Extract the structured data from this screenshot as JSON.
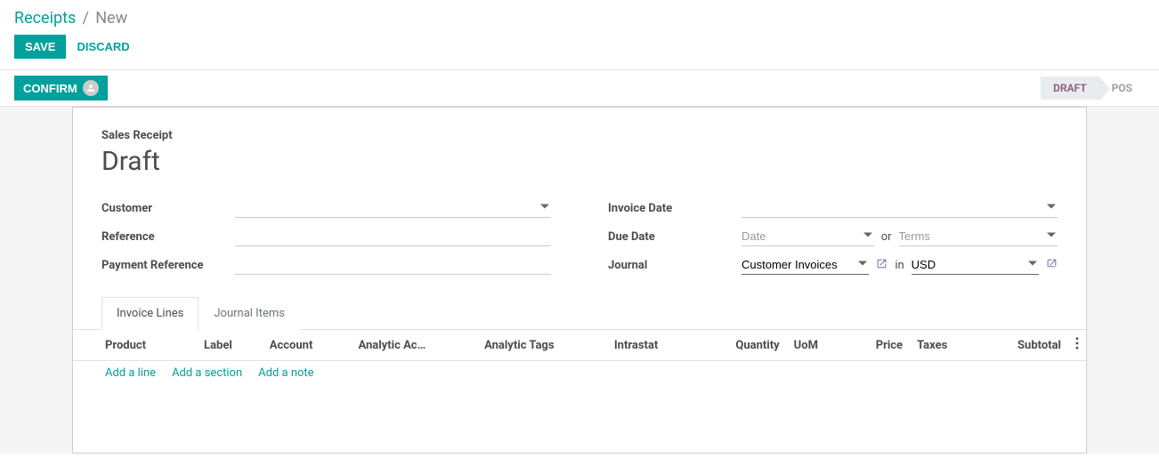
{
  "breadcrumb": {
    "root": "Receipts",
    "sep": "/",
    "current": "New"
  },
  "actions": {
    "save": "Save",
    "discard": "Discard"
  },
  "status": {
    "confirm": "Confirm",
    "draft": "Draft",
    "posted": "Pos"
  },
  "sheet": {
    "title_label": "Sales Receipt",
    "title": "Draft",
    "left_fields": {
      "customer_label": "Customer",
      "reference_label": "Reference",
      "payment_ref_label": "Payment Reference"
    },
    "right_fields": {
      "invoice_date_label": "Invoice Date",
      "due_date_label": "Due Date",
      "due_date_placeholder": "Date",
      "due_date_or": "or",
      "terms_placeholder": "Terms",
      "journal_label": "Journal",
      "journal_value": "Customer Invoices",
      "journal_in": "in",
      "currency_value": "USD"
    }
  },
  "tabs": {
    "invoice_lines": "Invoice Lines",
    "journal_items": "Journal Items"
  },
  "table": {
    "headers": {
      "product": "Product",
      "label": "Label",
      "account": "Account",
      "analytic_acc": "Analytic Ac…",
      "analytic_tags": "Analytic Tags",
      "intrastat": "Intrastat",
      "quantity": "Quantity",
      "uom": "UoM",
      "price": "Price",
      "taxes": "Taxes",
      "subtotal": "Subtotal"
    },
    "add_line": "Add a line",
    "add_section": "Add a section",
    "add_note": "Add a note"
  }
}
